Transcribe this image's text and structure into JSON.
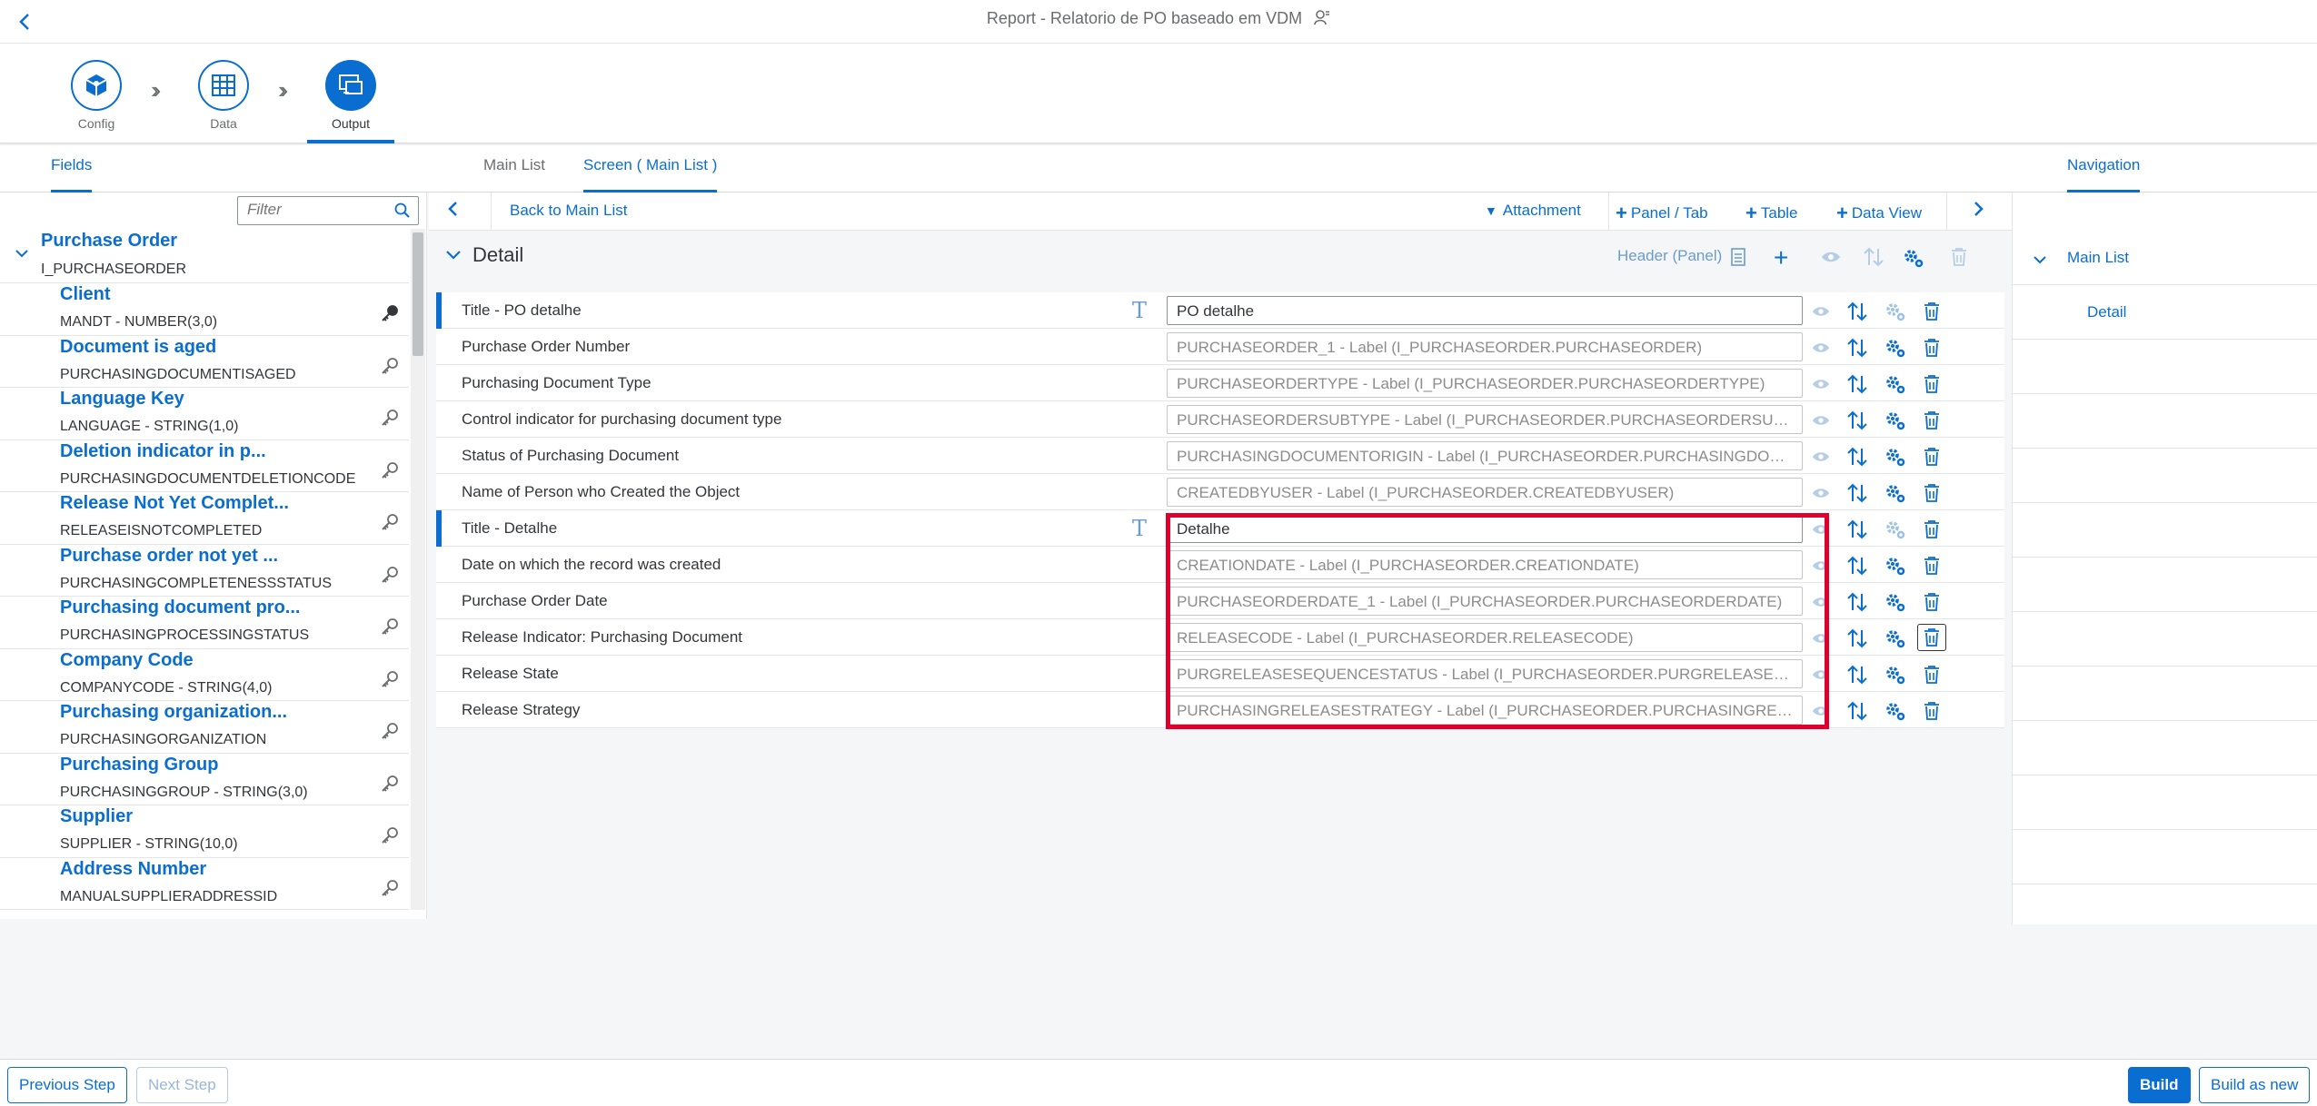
{
  "shell": {
    "title": "Report - Relatorio de PO baseado em VDM"
  },
  "wizard": {
    "steps": [
      {
        "label": "Config"
      },
      {
        "label": "Data"
      },
      {
        "label": "Output"
      }
    ]
  },
  "tabs": {
    "fields": "Fields",
    "main_list": "Main List",
    "screen_main_list": "Screen ( Main List )",
    "navigation": "Navigation"
  },
  "filter": {
    "placeholder": "Filter"
  },
  "toolbar": {
    "back_to_main_list": "Back to Main List",
    "attachment": "Attachment",
    "panel_tab": "Panel / Tab",
    "table": "Table",
    "data_view": "Data View"
  },
  "tree": {
    "root": {
      "title": "Purchase Order",
      "subtitle": "I_PURCHASEORDER"
    },
    "items": [
      {
        "name": "Client",
        "sub": "MANDT - NUMBER(3,0)"
      },
      {
        "name": "Document is aged",
        "sub": "PURCHASINGDOCUMENTISAGED"
      },
      {
        "name": "Language Key",
        "sub": "LANGUAGE - STRING(1,0)"
      },
      {
        "name": "Deletion indicator in p...",
        "sub": "PURCHASINGDOCUMENTDELETIONCODE"
      },
      {
        "name": "Release Not Yet Complet...",
        "sub": "RELEASEISNOTCOMPLETED"
      },
      {
        "name": "Purchase order not yet ...",
        "sub": "PURCHASINGCOMPLETENESSSTATUS"
      },
      {
        "name": "Purchasing document pro...",
        "sub": "PURCHASINGPROCESSINGSTATUS"
      },
      {
        "name": "Company Code",
        "sub": "COMPANYCODE - STRING(4,0)"
      },
      {
        "name": "Purchasing organization...",
        "sub": "PURCHASINGORGANIZATION"
      },
      {
        "name": "Purchasing Group",
        "sub": "PURCHASINGGROUP - STRING(3,0)"
      },
      {
        "name": "Supplier",
        "sub": "SUPPLIER - STRING(10,0)"
      },
      {
        "name": "Address Number",
        "sub": "MANUALSUPPLIERADDRESSID"
      }
    ]
  },
  "detail": {
    "title": "Detail",
    "header_panel": "Header (Panel)",
    "rows": [
      {
        "label": "Title - PO detalhe",
        "value": "PO detalhe",
        "placeholder": ""
      },
      {
        "label": "Purchase Order Number",
        "value": "",
        "placeholder": "PURCHASEORDER_1 - Label (I_PURCHASEORDER.PURCHASEORDER)"
      },
      {
        "label": "Purchasing Document Type",
        "value": "",
        "placeholder": "PURCHASEORDERTYPE - Label (I_PURCHASEORDER.PURCHASEORDERTYPE)"
      },
      {
        "label": "Control indicator for purchasing document type",
        "value": "",
        "placeholder": "PURCHASEORDERSUBTYPE - Label (I_PURCHASEORDER.PURCHASEORDERSUBT..."
      },
      {
        "label": "Status of Purchasing Document",
        "value": "",
        "placeholder": "PURCHASINGDOCUMENTORIGIN - Label (I_PURCHASEORDER.PURCHASINGDOC..."
      },
      {
        "label": "Name of Person who Created the Object",
        "value": "",
        "placeholder": "CREATEDBYUSER - Label (I_PURCHASEORDER.CREATEDBYUSER)"
      },
      {
        "label": "Title - Detalhe",
        "value": "Detalhe",
        "placeholder": ""
      },
      {
        "label": "Date on which the record was created",
        "value": "",
        "placeholder": "CREATIONDATE - Label (I_PURCHASEORDER.CREATIONDATE)"
      },
      {
        "label": "Purchase Order Date",
        "value": "",
        "placeholder": "PURCHASEORDERDATE_1 - Label (I_PURCHASEORDER.PURCHASEORDERDATE)"
      },
      {
        "label": "Release Indicator: Purchasing Document",
        "value": "",
        "placeholder": "RELEASECODE - Label (I_PURCHASEORDER.RELEASECODE)"
      },
      {
        "label": "Release State",
        "value": "",
        "placeholder": "PURGRELEASESEQUENCESTATUS - Label (I_PURCHASEORDER.PURGRELEASESE..."
      },
      {
        "label": "Release Strategy",
        "value": "",
        "placeholder": "PURCHASINGRELEASESTRATEGY - Label (I_PURCHASEORDER.PURCHASINGRELE..."
      }
    ]
  },
  "navigation": {
    "main_list": "Main List",
    "detail": "Detail"
  },
  "footer": {
    "previous_step": "Previous Step",
    "next_step": "Next Step",
    "build": "Build",
    "build_as_new": "Build as new"
  },
  "colors": {
    "accent": "#0a6ed1",
    "highlight": "#e1002d"
  }
}
